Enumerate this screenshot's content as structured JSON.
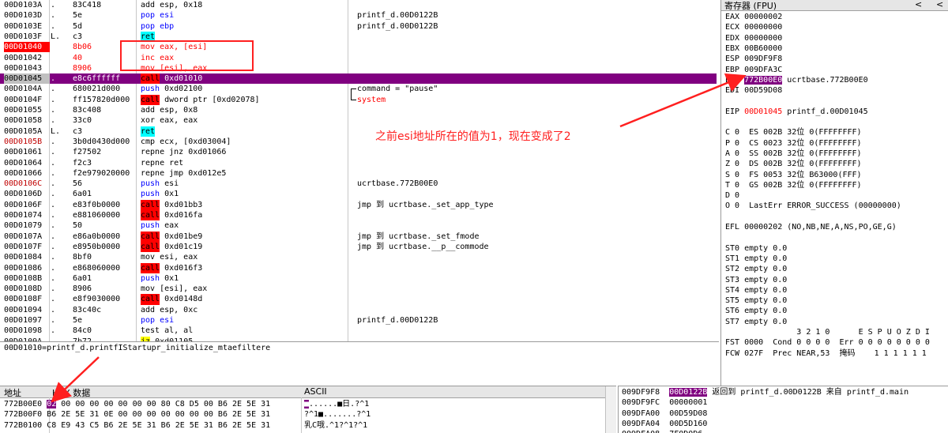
{
  "disasm": {
    "rows": [
      {
        "addr": "00D0103A",
        "mk": ".",
        "bytes": "83C418",
        "ins": [
          {
            "t": "add esp, 0x18",
            "k": ""
          }
        ],
        "cmt": ""
      },
      {
        "addr": "00D0103D",
        "mk": ".",
        "bytes": "5e",
        "ins": [
          {
            "t": "pop esi",
            "k": "push"
          }
        ],
        "cmt": "printf_d.00D0122B"
      },
      {
        "addr": "00D0103E",
        "mk": ".",
        "bytes": "5d",
        "ins": [
          {
            "t": "pop ebp",
            "k": "push"
          }
        ],
        "cmt": "printf_d.00D0122B"
      },
      {
        "addr": "00D0103F",
        "mk": "L.",
        "bytes": "c3",
        "ins": [
          {
            "t": "ret",
            "k": "ret"
          }
        ],
        "cmt": ""
      },
      {
        "addr": "00D01040",
        "addrStyle": "red",
        "mk": "",
        "bytes": "8b06",
        "bytesStyle": "red",
        "ins": [
          {
            "t": "mov eax, [esi]",
            "k": "redtxt"
          }
        ],
        "cmt": ""
      },
      {
        "addr": "00D01042",
        "mk": "",
        "bytes": "40",
        "bytesStyle": "red",
        "ins": [
          {
            "t": "inc eax",
            "k": "redtxt"
          }
        ],
        "cmt": ""
      },
      {
        "addr": "00D01043",
        "mk": "",
        "bytes": "8906",
        "bytesStyle": "red",
        "ins": [
          {
            "t": "mov [esi], eax",
            "k": "redtxt"
          }
        ],
        "cmt": ""
      },
      {
        "addr": "00D01045",
        "addrStyle": "cur",
        "rowStyle": "cur",
        "mk": ".",
        "bytes": "e8c6ffffff",
        "ins": [
          {
            "t": "call",
            "k": "call"
          },
          {
            "t": " 0xd01010",
            "k": ""
          }
        ],
        "cmt": ""
      },
      {
        "addr": "00D0104A",
        "mk": ".",
        "bytes": "680021d000",
        "ins": [
          {
            "t": "push",
            "k": "push"
          },
          {
            "t": " 0xd02100",
            "k": ""
          }
        ],
        "cmt": "command = \"pause\"",
        "bracket": "top"
      },
      {
        "addr": "00D0104F",
        "mk": ".",
        "bytes": "ff157820d000",
        "ins": [
          {
            "t": "call",
            "k": "call"
          },
          {
            "t": " dword ptr [0xd02078]",
            "k": ""
          }
        ],
        "cmt": "system",
        "cmtStyle": "red",
        "bracket": "bot"
      },
      {
        "addr": "00D01055",
        "mk": ".",
        "bytes": "83c408",
        "ins": [
          {
            "t": "add esp, 0x8",
            "k": ""
          }
        ],
        "cmt": ""
      },
      {
        "addr": "00D01058",
        "mk": ".",
        "bytes": "33c0",
        "ins": [
          {
            "t": "xor eax, eax",
            "k": ""
          }
        ],
        "cmt": ""
      },
      {
        "addr": "00D0105A",
        "mk": "L.",
        "bytes": "c3",
        "ins": [
          {
            "t": "ret",
            "k": "ret"
          }
        ],
        "cmt": ""
      },
      {
        "addr": "00D0105B",
        "addrStyle": "redtext",
        "mk": ".",
        "bytes": "3b0d0430d000",
        "ins": [
          {
            "t": "cmp ecx, [0xd03004]",
            "k": ""
          }
        ],
        "cmt": ""
      },
      {
        "addr": "00D01061",
        "mk": ".",
        "bytes": "f27502",
        "ins": [
          {
            "t": "repne jnz 0xd01066",
            "k": ""
          }
        ],
        "cmt": ""
      },
      {
        "addr": "00D01064",
        "mk": ".",
        "bytes": "f2c3",
        "ins": [
          {
            "t": "repne ret",
            "k": ""
          }
        ],
        "cmt": ""
      },
      {
        "addr": "00D01066",
        "mk": ".",
        "bytes": "f2e979020000",
        "ins": [
          {
            "t": "repne jmp 0xd012e5",
            "k": ""
          }
        ],
        "cmt": ""
      },
      {
        "addr": "00D0106C",
        "addrStyle": "redtext",
        "mk": ".",
        "bytes": "56",
        "ins": [
          {
            "t": "push",
            "k": "push"
          },
          {
            "t": " esi",
            "k": ""
          }
        ],
        "cmt": "ucrtbase.772B00E0"
      },
      {
        "addr": "00D0106D",
        "mk": ".",
        "bytes": "6a01",
        "ins": [
          {
            "t": "push",
            "k": "push"
          },
          {
            "t": " 0x1",
            "k": ""
          }
        ],
        "cmt": ""
      },
      {
        "addr": "00D0106F",
        "mk": ".",
        "bytes": "e83f0b0000",
        "ins": [
          {
            "t": "call",
            "k": "call"
          },
          {
            "t": " 0xd01bb3",
            "k": ""
          }
        ],
        "cmt": "jmp 到 ucrtbase._set_app_type"
      },
      {
        "addr": "00D01074",
        "mk": ".",
        "bytes": "e881060000",
        "ins": [
          {
            "t": "call",
            "k": "call"
          },
          {
            "t": " 0xd016fa",
            "k": ""
          }
        ],
        "cmt": ""
      },
      {
        "addr": "00D01079",
        "mk": ".",
        "bytes": "50",
        "ins": [
          {
            "t": "push",
            "k": "push"
          },
          {
            "t": " eax",
            "k": ""
          }
        ],
        "cmt": ""
      },
      {
        "addr": "00D0107A",
        "mk": ".",
        "bytes": "e86a0b0000",
        "ins": [
          {
            "t": "call",
            "k": "call"
          },
          {
            "t": " 0xd01be9",
            "k": ""
          }
        ],
        "cmt": "jmp 到 ucrtbase._set_fmode"
      },
      {
        "addr": "00D0107F",
        "mk": ".",
        "bytes": "e8950b0000",
        "ins": [
          {
            "t": "call",
            "k": "call"
          },
          {
            "t": " 0xd01c19",
            "k": ""
          }
        ],
        "cmt": "jmp 到 ucrtbase.__p__commode"
      },
      {
        "addr": "00D01084",
        "mk": ".",
        "bytes": "8bf0",
        "ins": [
          {
            "t": "mov esi, eax",
            "k": ""
          }
        ],
        "cmt": ""
      },
      {
        "addr": "00D01086",
        "mk": ".",
        "bytes": "e868060000",
        "ins": [
          {
            "t": "call",
            "k": "call"
          },
          {
            "t": " 0xd016f3",
            "k": ""
          }
        ],
        "cmt": ""
      },
      {
        "addr": "00D0108B",
        "mk": ".",
        "bytes": "6a01",
        "ins": [
          {
            "t": "push",
            "k": "push"
          },
          {
            "t": " 0x1",
            "k": ""
          }
        ],
        "cmt": ""
      },
      {
        "addr": "00D0108D",
        "mk": ".",
        "bytes": "8906",
        "ins": [
          {
            "t": "mov [esi], eax",
            "k": ""
          }
        ],
        "cmt": ""
      },
      {
        "addr": "00D0108F",
        "mk": ".",
        "bytes": "e8f9030000",
        "ins": [
          {
            "t": "call",
            "k": "call"
          },
          {
            "t": " 0xd0148d",
            "k": ""
          }
        ],
        "cmt": ""
      },
      {
        "addr": "00D01094",
        "mk": ".",
        "bytes": "83c40c",
        "ins": [
          {
            "t": "add esp, 0xc",
            "k": ""
          }
        ],
        "cmt": ""
      },
      {
        "addr": "00D01097",
        "mk": ".",
        "bytes": "5e",
        "ins": [
          {
            "t": "pop esi",
            "k": "push"
          }
        ],
        "cmt": "printf_d.00D0122B"
      },
      {
        "addr": "00D01098",
        "mk": ".",
        "bytes": "84c0",
        "ins": [
          {
            "t": "test al, al",
            "k": ""
          }
        ],
        "cmt": ""
      },
      {
        "addr": "00D0109A",
        "mk": ".",
        "bytes": "7b72",
        "ins": [
          {
            "t": "jz",
            "k": "jcc"
          },
          {
            "t": " 0xd01105",
            "k": ""
          }
        ],
        "cmt": ""
      }
    ]
  },
  "info_line": "00D01010=printf_d.printfIStartupr_initialize_mtaefiltere",
  "registers": {
    "title": "寄存器 (FPU)",
    "nav_left": "<",
    "nav_right": "<",
    "lines": [
      {
        "t": "EAX 00000002"
      },
      {
        "t": "ECX 00000000"
      },
      {
        "t": "EDX 00000000"
      },
      {
        "t": "EBX 00B60000"
      },
      {
        "t": "ESP 009DF9F8"
      },
      {
        "t": "EBP 009DFA3C"
      },
      {
        "t": "ESI ",
        "hl": "772B00E0",
        "hlStyle": "esi",
        "rest": " ucrtbase.772B00E0"
      },
      {
        "t": "EDI 00D59D08"
      },
      {
        "t": ""
      },
      {
        "t": "EIP ",
        "hl": "00D01045",
        "hlStyle": "red",
        "rest": " printf_d.00D01045"
      },
      {
        "t": ""
      },
      {
        "t": "C 0  ES 002B 32位 0(FFFFFFFF)"
      },
      {
        "t": "P 0  CS 0023 32位 0(FFFFFFFF)"
      },
      {
        "t": "A 0  SS 002B 32位 0(FFFFFFFF)"
      },
      {
        "t": "Z 0  DS 002B 32位 0(FFFFFFFF)"
      },
      {
        "t": "S 0  FS 0053 32位 B63000(FFF)"
      },
      {
        "t": "T 0  GS 002B 32位 0(FFFFFFFF)"
      },
      {
        "t": "D 0"
      },
      {
        "t": "O 0  LastErr ERROR_SUCCESS (00000000)"
      },
      {
        "t": ""
      },
      {
        "t": "EFL 00000202 (NO,NB,NE,A,NS,PO,GE,G)"
      },
      {
        "t": ""
      },
      {
        "t": "ST0 empty 0.0"
      },
      {
        "t": "ST1 empty 0.0"
      },
      {
        "t": "ST2 empty 0.0"
      },
      {
        "t": "ST3 empty 0.0"
      },
      {
        "t": "ST4 empty 0.0"
      },
      {
        "t": "ST5 empty 0.0"
      },
      {
        "t": "ST6 empty 0.0"
      },
      {
        "t": "ST7 empty 0.0"
      },
      {
        "t": "               3 2 1 0      E S P U O Z D I"
      },
      {
        "t": "FST 0000  Cond 0 0 0 0  Err 0 0 0 0 0 0 0 0"
      },
      {
        "t": "FCW 027F  Prec NEAR,53  掩码    1 1 1 1 1 1"
      }
    ]
  },
  "dump": {
    "col_addr": "地址",
    "col_hex": "HEX 数据",
    "col_ascii": "ASCII",
    "rows": [
      {
        "addr": "772B00E0",
        "sel": "02",
        "hex": " 00 00 00 00 00 00 00 80 C8 D5 00 B6 2E 5E 31",
        "ascii_sel": "■",
        "ascii": "......■日.?^1"
      },
      {
        "addr": "772B00F0",
        "hex": "B6 2E 5E 31 0E 00 00 00 00 00 00 00 B6 2E 5E 31",
        "ascii": "?^1■.......?^1"
      },
      {
        "addr": "772B0100",
        "hex": "C8 E9 43 C5 B6 2E 5E 31 B6 2E 5E 31 B6 2E 5E 31",
        "ascii": "乳C哦.^1?^1?^1"
      }
    ]
  },
  "stack": {
    "rows": [
      {
        "addr": "009DF9F8",
        "val": "00D0122B",
        "cmt": "返回到 printf_d.00D0122B 来自 printf_d.main",
        "cur": true
      },
      {
        "addr": "009DF9FC",
        "val": "00000001",
        "cmt": ""
      },
      {
        "addr": "009DFA00",
        "val": "00D59D08",
        "cmt": ""
      },
      {
        "addr": "009DFA04",
        "val": "00D5D160",
        "cmt": ""
      },
      {
        "addr": "009DFA08",
        "val": "7F0D0D6",
        "cmt": ""
      }
    ]
  },
  "annotation": {
    "text": "之前esi地址所在的值为1，现在变成了2",
    "color": "#ff1f1f"
  },
  "colors": {
    "current_line": "#800080",
    "breakpoint": "#ff0000",
    "call_highlight": "#ff0000",
    "ret_highlight": "#00ffff",
    "push_pop_text": "#0000ff"
  }
}
